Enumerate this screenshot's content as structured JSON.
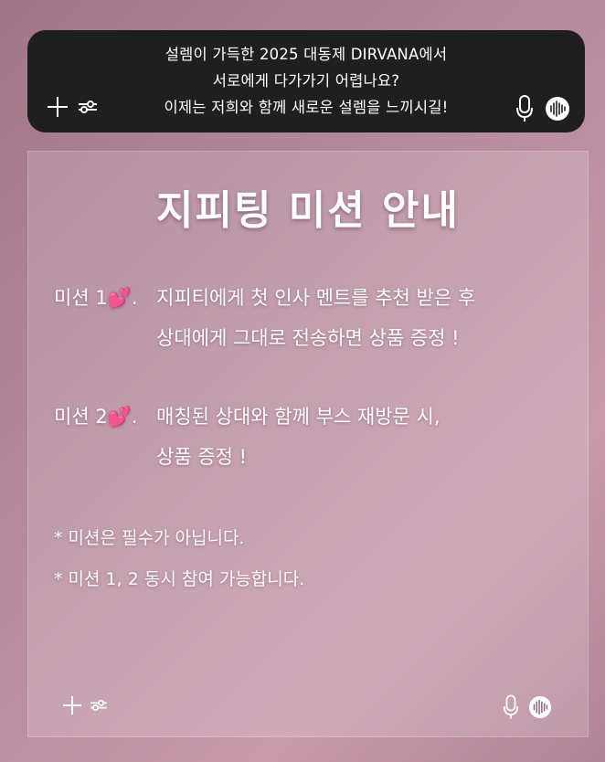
{
  "chat_bar": {
    "message_lines": [
      "설렘이 가득한 2025 대동제 DIRVANA에서",
      "서로에게 다가가기 어렵나요?",
      "이제는 저희와 함께 새로운 설렘을 느끼시길!"
    ],
    "icons": [
      "plus-icon",
      "settings-sliders-icon",
      "microphone-icon",
      "voice-wave-icon"
    ]
  },
  "card": {
    "title": "지피팅 미션 안내",
    "mission1": {
      "tag": "미션 1💕.",
      "line1": "지피티에게 첫 인사 멘트를 추천 받은 후",
      "line2": "상대에게 그대로 전송하면 상품 증정 !"
    },
    "mission2": {
      "tag": "미션 2💕.",
      "line1": "매칭된 상대와 함께 부스 재방문 시,",
      "line2": "상품 증정 !"
    },
    "notes": [
      "* 미션은 필수가 아닙니다.",
      "* 미션 1, 2 동시 참여 가능합니다."
    ]
  }
}
